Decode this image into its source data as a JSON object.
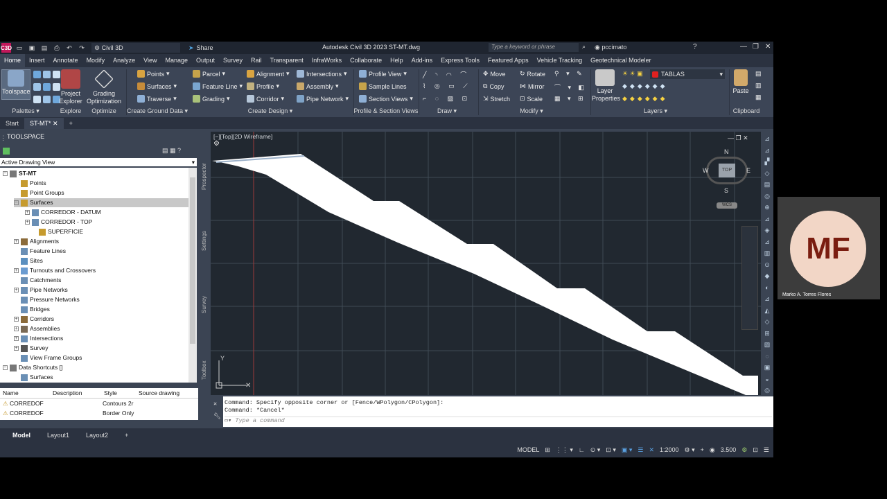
{
  "window": {
    "app_icon": "C3D",
    "workspace": "Civil 3D",
    "share": "Share",
    "title": "Autodesk Civil 3D 2023   ST-MT.dwg",
    "search_placeholder": "Type a keyword or phrase",
    "user": "pccimato"
  },
  "menu": [
    "Home",
    "Insert",
    "Annotate",
    "Modify",
    "Analyze",
    "View",
    "Manage",
    "Output",
    "Survey",
    "Rail",
    "Transparent",
    "InfraWorks",
    "Collaborate",
    "Help",
    "Add-ins",
    "Express Tools",
    "Featured Apps",
    "Vehicle Tracking",
    "Geotechnical Modeler"
  ],
  "ribbon": {
    "toolspace": "Toolspace",
    "project_explorer_1": "Project",
    "project_explorer_2": "Explorer",
    "grading_opt_1": "Grading",
    "grading_opt_2": "Optimization",
    "points": "Points",
    "surfaces": "Surfaces",
    "traverse": "Traverse",
    "parcel": "Parcel",
    "feature_line": "Feature Line",
    "grading": "Grading",
    "alignment": "Alignment",
    "profile": "Profile",
    "corridor": "Corridor",
    "intersections": "Intersections",
    "assembly": "Assembly",
    "pipe_network": "Pipe Network",
    "profile_view": "Profile View",
    "sample_lines": "Sample Lines",
    "section_views": "Section Views",
    "move": "Move",
    "rotate": "Rotate",
    "copy": "Copy",
    "mirror": "Mirror",
    "stretch": "Stretch",
    "scale": "Scale",
    "layer_props_1": "Layer",
    "layer_props_2": "Properties",
    "layer_name": "TABLAS",
    "paste": "Paste",
    "groups": {
      "palettes": "Palettes",
      "explore": "Explore",
      "optimize": "Optimize",
      "create_ground": "Create Ground Data",
      "create_design": "Create Design",
      "profile_section": "Profile & Section Views",
      "draw": "Draw",
      "modify": "Modify",
      "layers": "Layers",
      "clipboard": "Clipboard"
    }
  },
  "doc_tabs": {
    "start": "Start",
    "active": "ST-MT*"
  },
  "toolspace": {
    "title": "TOOLSPACE",
    "view": "Active Drawing View",
    "vtabs": [
      "Prospector",
      "Settings",
      "Survey",
      "Toolbox"
    ],
    "tree": [
      {
        "label": "ST-MT",
        "bold": true
      },
      {
        "label": "Points"
      },
      {
        "label": "Point Groups"
      },
      {
        "label": "Surfaces",
        "selected": true
      },
      {
        "label": "CORREDOR - DATUM"
      },
      {
        "label": "CORREDOR - TOP"
      },
      {
        "label": "SUPERFICIE"
      },
      {
        "label": "Alignments"
      },
      {
        "label": "Feature Lines"
      },
      {
        "label": "Sites"
      },
      {
        "label": "Turnouts and Crossovers"
      },
      {
        "label": "Catchments"
      },
      {
        "label": "Pipe Networks"
      },
      {
        "label": "Pressure Networks"
      },
      {
        "label": "Bridges"
      },
      {
        "label": "Corridors"
      },
      {
        "label": "Assemblies"
      },
      {
        "label": "Intersections"
      },
      {
        "label": "Survey"
      },
      {
        "label": "View Frame Groups"
      },
      {
        "label": "Data Shortcuts []"
      },
      {
        "label": "Surfaces"
      }
    ],
    "list_headers": [
      "Name",
      "Description",
      "Style",
      "Source drawing"
    ],
    "list_rows": [
      {
        "name": "CORREDOF",
        "style": "Contours 2r"
      },
      {
        "name": "CORREDOF",
        "style": "Border Only"
      }
    ]
  },
  "viewport": {
    "label": "[−][Top][2D Wireframe]",
    "compass": {
      "n": "N",
      "s": "S",
      "e": "E",
      "w": "W",
      "top": "TOP",
      "wcs": "WCS"
    },
    "ucs_y": "Y"
  },
  "command": {
    "line1": "Command: Specify opposite corner or [Fence/WPolygon/CPolygon]:",
    "line2": "Command: *Cancel*",
    "placeholder": "Type a command"
  },
  "layout_tabs": [
    "Model",
    "Layout1",
    "Layout2"
  ],
  "status": {
    "model": "MODEL",
    "scale": "1:2000",
    "lineweight": "3.500"
  },
  "webcam": {
    "initials": "MF",
    "name": "Marko A. Torres Flores"
  }
}
